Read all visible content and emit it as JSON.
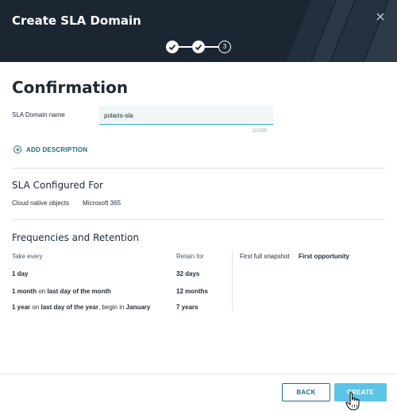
{
  "dialog": {
    "title": "Create SLA Domain",
    "steps": [
      {
        "label": "✓",
        "state": "done"
      },
      {
        "label": "✓",
        "state": "done"
      },
      {
        "label": "3",
        "state": "current"
      }
    ]
  },
  "confirmation": {
    "heading": "Confirmation",
    "name_label": "SLA Domain name",
    "name_value": "polaris-sla",
    "char_counter": "11/255",
    "add_description": "ADD DESCRIPTION"
  },
  "configured_for": {
    "heading": "SLA Configured For",
    "label": "Cloud native objects",
    "value": "Microsoft 365"
  },
  "frequencies": {
    "heading": "Frequencies and Retention",
    "take_every_header": "Take every",
    "retain_for_header": "Retain for",
    "rows": [
      {
        "bold1": "1 day",
        "mid": "",
        "bold2": "",
        "tail": "",
        "bold3": "",
        "retain": "32 days"
      },
      {
        "bold1": "1 month",
        "mid": " on ",
        "bold2": "last day of the month",
        "tail": "",
        "bold3": "",
        "retain": "12 months"
      },
      {
        "bold1": "1 year",
        "mid": " on ",
        "bold2": "last day of the year",
        "tail": ", begin in ",
        "bold3": "January",
        "retain": "7 years"
      }
    ],
    "first_full_snapshot_label": "First full snapshot",
    "first_full_snapshot_value": "First opportunity"
  },
  "footer": {
    "back_label": "BACK",
    "create_label": "CREATE"
  },
  "colors": {
    "header_bg": "#1c2633",
    "accent": "#1c6d86",
    "create_button": "#5cc4e6",
    "input_bg": "#f0f6f6"
  }
}
